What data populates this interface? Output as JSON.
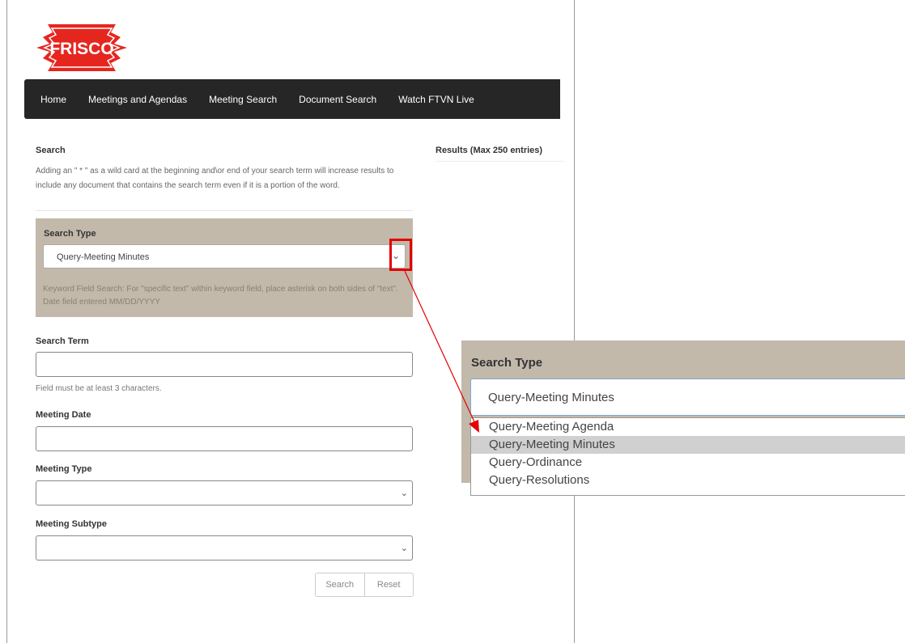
{
  "logo": {
    "text": "FRISCO"
  },
  "nav": {
    "items": [
      "Home",
      "Meetings and Agendas",
      "Meeting Search",
      "Document Search",
      "Watch FTVN Live"
    ]
  },
  "search": {
    "heading": "Search",
    "help_text": "Adding an \" * \" as a wild card at the beginning and\\or end of your search term will increase results to include any document that contains the search term even if it is a portion of the word."
  },
  "results": {
    "heading": "Results (Max 250 entries)"
  },
  "search_type": {
    "label": "Search Type",
    "selected": "Query-Meeting Minutes",
    "description": "Keyword Field Search: For \"specific text\" within keyword field, place asterisk on both sides of \"text\". Date field entered MM/DD/YYYY"
  },
  "search_term": {
    "label": "Search Term",
    "value": "",
    "hint": "Field must be at least 3 characters."
  },
  "meeting_date": {
    "label": "Meeting Date",
    "value": ""
  },
  "meeting_type": {
    "label": "Meeting Type",
    "selected": ""
  },
  "meeting_subtype": {
    "label": "Meeting Subtype",
    "selected": ""
  },
  "buttons": {
    "search": "Search",
    "reset": "Reset"
  },
  "zoom": {
    "label": "Search Type",
    "selected": "Query-Meeting Minutes",
    "options": [
      "Query-Meeting Agenda",
      "Query-Meeting Minutes",
      "Query-Ordinance",
      "Query-Resolutions"
    ],
    "selected_index": 1
  },
  "colors": {
    "nav_bg": "#262626",
    "panel_bg": "#c2b9ab",
    "highlight": "#e30000",
    "logo_red": "#e5261f"
  },
  "icons": {
    "caret": "chevron-down-icon"
  }
}
